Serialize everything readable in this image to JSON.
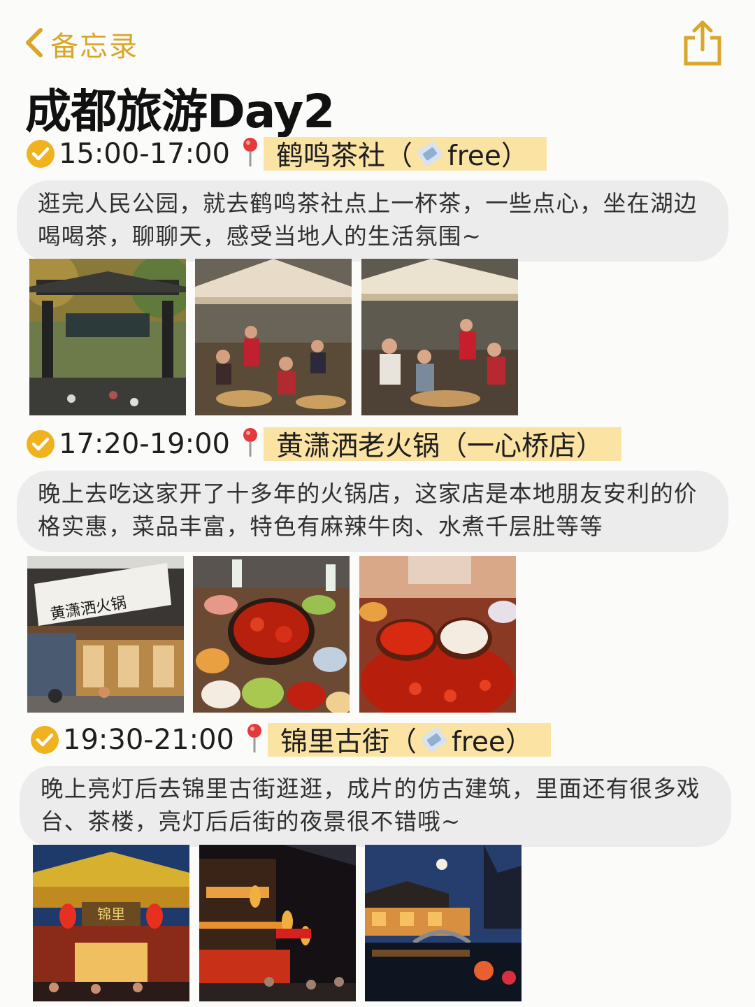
{
  "nav": {
    "back_label": "备忘录",
    "accent": "#d9a62a"
  },
  "title": "成都旅游Day2",
  "sections": [
    {
      "time": "15:00-17:00",
      "place_name": "鹤鸣茶社（",
      "place_suffix": "free）",
      "has_ticket_icon": true,
      "description": "逛完人民公园，就去鹤鸣茶社点上一杯茶，一些点心，坐在湖边喝喝茶，聊聊天，感受当地人的生活氛围~",
      "photos": [
        "gate-photo",
        "teahouse-umbrella-photo",
        "teahouse-crowd-photo"
      ]
    },
    {
      "time": "17:20-19:00",
      "place_name": "黄潇洒老火锅（一心桥店）",
      "place_suffix": "",
      "has_ticket_icon": false,
      "description": "晚上去吃这家开了十多年的火锅店，这家店是本地朋友安利的价格实惠，菜品丰富，特色有麻辣牛肉、水煮千层肚等等",
      "photos": [
        "hotpot-storefront-photo",
        "hotpot-table-photo",
        "hotpot-dishes-photo"
      ],
      "sign_text": "黄潇洒火锅"
    },
    {
      "time": "19:30-21:00",
      "place_name": "锦里古街（",
      "place_suffix": "free）",
      "has_ticket_icon": true,
      "description": "晚上亮灯后去锦里古街逛逛，成片的仿古建筑，里面还有很多戏台、茶楼，亮灯后后街的夜景很不错哦~",
      "photos": [
        "jinli-gate-photo",
        "jinli-street-photo",
        "jinli-waterside-photo"
      ],
      "sign_text": "锦里"
    }
  ],
  "colors": {
    "check": "#f0b31e",
    "highlight": "#fbe3a4",
    "bubble": "#ececec"
  }
}
